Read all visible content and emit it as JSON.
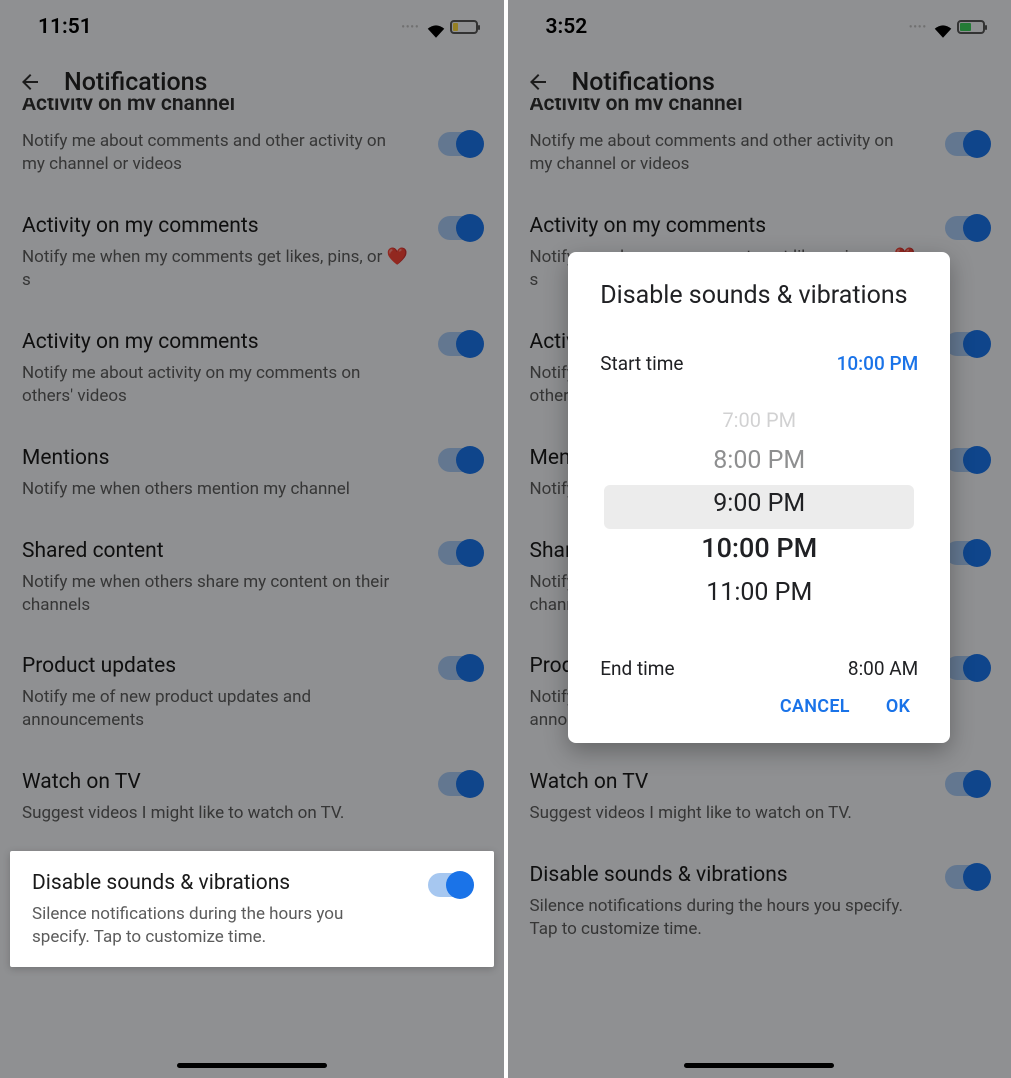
{
  "left": {
    "time": "11:51",
    "header": "Notifications",
    "rows": [
      {
        "title": "Activity on my channel",
        "sub": "Notify me about comments and other activity on my channel or videos",
        "truncated": true
      },
      {
        "title": "Activity on my comments",
        "sub": "Notify me when my comments get likes, pins, or ❤️s"
      },
      {
        "title": "Activity on my comments",
        "sub": "Notify me about activity on my comments on others' videos"
      },
      {
        "title": "Mentions",
        "sub": "Notify me when others mention my channel"
      },
      {
        "title": "Shared content",
        "sub": "Notify me when others share my content on their channels"
      },
      {
        "title": "Product updates",
        "sub": "Notify me of new product updates and announcements"
      },
      {
        "title": "Watch on TV",
        "sub": "Suggest videos I might like to watch on TV."
      },
      {
        "title": "Disable sounds & vibrations",
        "sub": "Silence notifications during the hours you specify. Tap to customize time.",
        "highlight": true
      }
    ]
  },
  "right": {
    "time": "3:52",
    "header": "Notifications",
    "rows": [
      {
        "title": "Activity on my channel",
        "sub": "Notify me about comments and other activity on my channel or videos",
        "truncated": true
      },
      {
        "title": "Activity on my comments",
        "sub": "Notify me when my comments get likes, pins, or ❤️s"
      },
      {
        "title": "Activity on my comments",
        "sub": "Notify me about activity on my comments on others' videos"
      },
      {
        "title": "Mentions",
        "sub": "Notify me when others mention my channel"
      },
      {
        "title": "Shared content",
        "sub": "Notify me when others share my content on their channels"
      },
      {
        "title": "Product updates",
        "sub": "Notify me of new product updates and announcements"
      },
      {
        "title": "Watch on TV",
        "sub": "Suggest videos I might like to watch on TV."
      },
      {
        "title": "Disable sounds & vibrations",
        "sub": "Silence notifications during the hours you specify. Tap to customize time."
      }
    ],
    "dialog": {
      "title": "Disable sounds & vibrations",
      "start_label": "Start time",
      "start_value": "10:00 PM",
      "end_label": "End time",
      "end_value": "8:00 AM",
      "options": [
        "7:00 PM",
        "8:00 PM",
        "9:00 PM",
        "10:00 PM",
        "11:00 PM"
      ],
      "selected_index": 3,
      "cancel": "CANCEL",
      "ok": "OK"
    }
  }
}
